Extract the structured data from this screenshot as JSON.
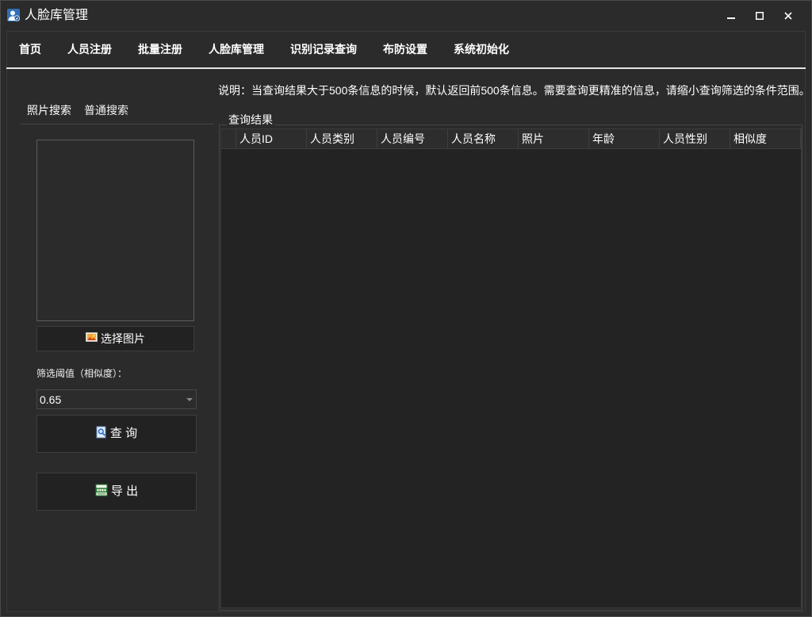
{
  "window": {
    "title": "人脸库管理"
  },
  "menu": {
    "items": [
      {
        "label": "首页"
      },
      {
        "label": "人员注册"
      },
      {
        "label": "批量注册"
      },
      {
        "label": "人脸库管理"
      },
      {
        "label": "识别记录查询"
      },
      {
        "label": "布防设置"
      },
      {
        "label": "系统初始化"
      }
    ]
  },
  "search": {
    "tabs": [
      {
        "label": "照片搜索",
        "active": true
      },
      {
        "label": "普通搜索",
        "active": false
      }
    ],
    "select_image_button": {
      "label": "选择图片",
      "icon": "image-icon"
    },
    "threshold": {
      "label": "筛选阈值（相似度）：",
      "value": "0.65"
    },
    "query_button": {
      "label": "查 询",
      "icon": "search-document-icon"
    },
    "export_button": {
      "label": "导 出",
      "icon": "excel-export-icon"
    }
  },
  "note": "说明：当查询结果大于500条信息的时候，默认返回前500条信息。需要查询更精准的信息，请缩小查询筛选的条件范围。",
  "results": {
    "title": "查询结果",
    "columns": [
      "人员ID",
      "人员类别",
      "人员编号",
      "人员名称",
      "照片",
      "年龄",
      "人员性别",
      "相似度"
    ],
    "rows": []
  },
  "icons": {
    "app": "face-database-app-icon",
    "minimize": "minimize-icon",
    "maximize": "maximize-icon",
    "close": "close-icon"
  },
  "colors": {
    "window_bg": "#2b2b2b",
    "accent_line": "#e6e6e6",
    "table_body_bg": "#232323",
    "table_header_bg": "#2d2d2d",
    "button_bg": "#222222"
  }
}
